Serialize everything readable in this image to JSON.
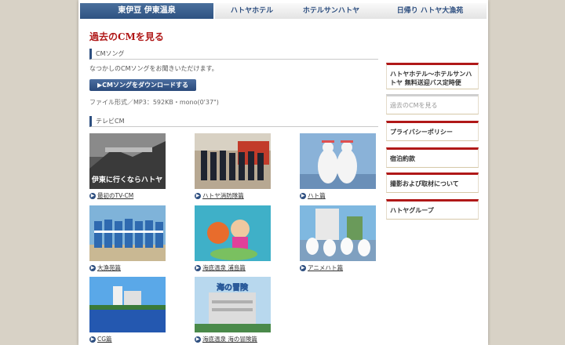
{
  "nav": {
    "home": "東伊豆 伊東温泉",
    "tabs": [
      "ハトヤホテル",
      "ホテルサンハトヤ",
      "日帰り ハトヤ大漁苑"
    ]
  },
  "page_title": "過去のCMを見る",
  "cm_song": {
    "heading": "CMソング",
    "description": "なつかしのCMソングをお聞きいただけます。",
    "download_button": "▶CMソングをダウンロードする",
    "file_info": "ファイル形式／MP3：592KB・mono(0'37\")"
  },
  "tv_cm": {
    "heading": "テレビCM",
    "items": [
      {
        "label": "最初のTV-CM",
        "caption": "伊東に行くならハトヤ"
      },
      {
        "label": "ハトヤ消防隊篇"
      },
      {
        "label": "ハト篇"
      },
      {
        "label": "大漁苑篇"
      },
      {
        "label": "海底温泉 浦島篇"
      },
      {
        "label": "アニメハト篇"
      },
      {
        "label": "CG篇"
      },
      {
        "label": "海底温泉 海の冒険篇",
        "caption": "海の冒険"
      }
    ]
  },
  "sidebar": {
    "items": [
      {
        "label": "ハトヤホテル〜ホテルサンハトヤ 無料送迎バス定時便",
        "dim": false
      },
      {
        "label": "過去のCMを見る",
        "dim": true
      },
      {
        "label": "プライバシーポリシー",
        "dim": false
      },
      {
        "label": "宿泊約款",
        "dim": false
      },
      {
        "label": "撮影および取材について",
        "dim": false
      },
      {
        "label": "ハトヤグループ",
        "dim": false
      }
    ]
  },
  "colors": {
    "accent_red": "#b01818",
    "navy": "#2e4f80"
  }
}
